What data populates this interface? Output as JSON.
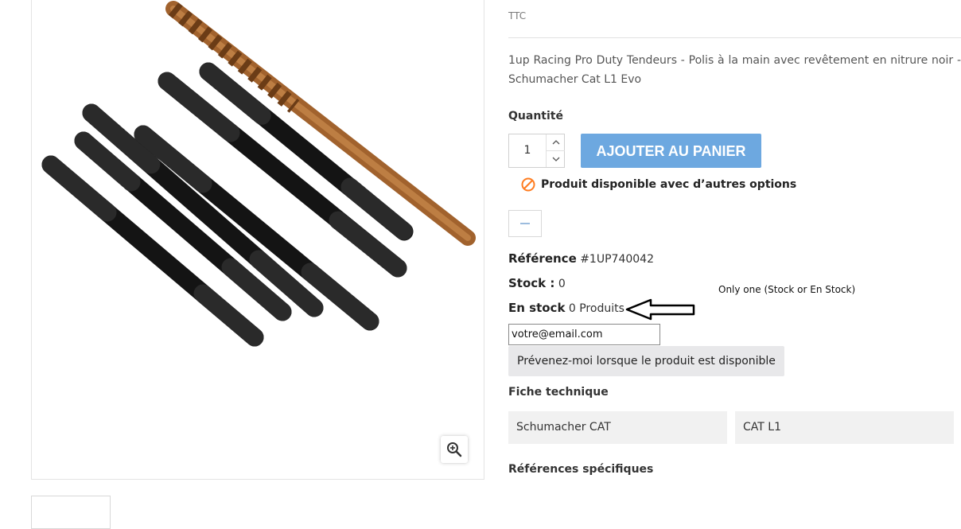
{
  "product": {
    "brand": "TTC",
    "description": "1up Racing Pro Duty Tendeurs - Polis à la main avec revêtement en nitrure noir - Schumacher Cat L1 Evo"
  },
  "quantity": {
    "label": "Quantité",
    "value": "1",
    "up_icon": "chevron-up-icon",
    "down_icon": "chevron-down-icon"
  },
  "cart": {
    "add_label": "AJOUTER AU PANIER",
    "color": "#6da8e0"
  },
  "availability": {
    "text": "Produit disponible avec d’autres options",
    "icon": "unavailable-icon",
    "color": "#ff7c1f"
  },
  "reference": {
    "label": "Référence",
    "value": "#1UP740042"
  },
  "stock": {
    "label": "Stock :",
    "value": "0"
  },
  "en_stock": {
    "label": "En stock",
    "value": "0 Produits"
  },
  "annotation": {
    "text": "Only one  (Stock or En Stock)"
  },
  "notify": {
    "email_value": "votre@email.com",
    "button_label": "Prévenez-moi lorsque le produit est disponible"
  },
  "features": {
    "title": "Fiche technique",
    "values": [
      "Schumacher CAT",
      "CAT L1"
    ]
  },
  "specific_refs": {
    "title": "Références spécifiques"
  },
  "zoom": {
    "icon": "zoom-in-icon"
  }
}
